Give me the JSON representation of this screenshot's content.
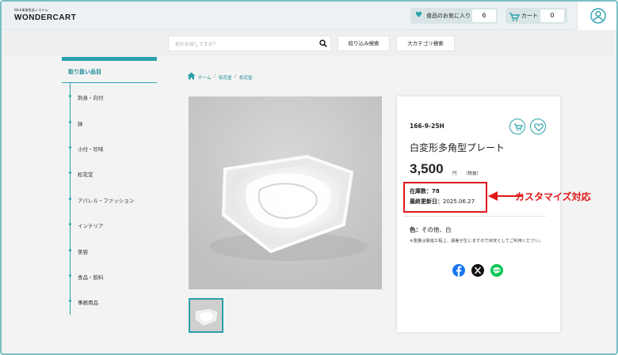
{
  "header": {
    "logo_sub": "Web事業推進システム",
    "logo_main": "WONDERCART",
    "favorites_label": "食品のお気に入り",
    "favorites_count": "6",
    "cart_label": "カート",
    "cart_count": "0"
  },
  "search": {
    "placeholder": "何かお探しですか？",
    "filter_label": "絞り込み検索",
    "category_label": "大カテゴリ検索"
  },
  "sidebar": {
    "title": "取り扱い品目",
    "items": [
      {
        "label": "刺身・向付"
      },
      {
        "label": "鉢"
      },
      {
        "label": "小付・珍味"
      },
      {
        "label": "松花堂"
      },
      {
        "label": "アパレル・ファッション"
      },
      {
        "label": "インテリア"
      },
      {
        "label": "美容"
      },
      {
        "label": "食品・飲料"
      },
      {
        "label": "事務用品"
      }
    ]
  },
  "breadcrumb": {
    "home": "ホーム",
    "level1": "松花堂",
    "level2": "松花堂",
    "separator": "/"
  },
  "product": {
    "sku": "166-9-25H",
    "name": "白変形多角型プレート",
    "price": "3,500",
    "price_unit": "円",
    "tax_note": "（税抜）",
    "stock_label": "在庫数：",
    "stock_value": "78",
    "updated_label": "最終更新日：",
    "updated_value": "2025.06.27",
    "color_label": "色：",
    "color_value": "その他、白",
    "note": "※重量は製造工程上、誤差が生じますので目安としてご利用ください。"
  },
  "share": {
    "facebook": "facebook-icon",
    "x": "x-icon",
    "line": "line-icon"
  },
  "annotation": {
    "text": "カスタマイズ対応"
  },
  "colors": {
    "accent": "#2aa2ac",
    "annotation": "#e01818",
    "facebook": "#1877f2",
    "line": "#06c755"
  }
}
